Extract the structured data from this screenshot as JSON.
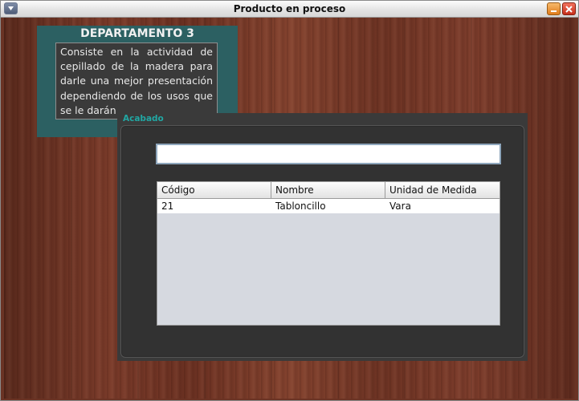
{
  "window": {
    "title": "Producto en proceso",
    "controls": [
      "menu-icon",
      "minimize-icon",
      "close-icon"
    ]
  },
  "department": {
    "title": "DEPARTAMENTO 3",
    "description": "Consiste en la actividad de cepillado de la madera para darle una mejor presentación dependiendo de los usos que se le darán"
  },
  "panel": {
    "title": "Acabado",
    "search": {
      "value": "",
      "placeholder": ""
    },
    "table": {
      "headers": [
        "Código",
        "Nombre",
        "Unidad de Medida"
      ],
      "rows": [
        [
          "21",
          "Tabloncillo",
          "Vara"
        ]
      ]
    }
  },
  "colors": {
    "department_bg": "#2c6062",
    "panel_title": "#21a7a3",
    "panel_bg": "#3a3a3a",
    "table_bg": "#d6d9e0"
  }
}
